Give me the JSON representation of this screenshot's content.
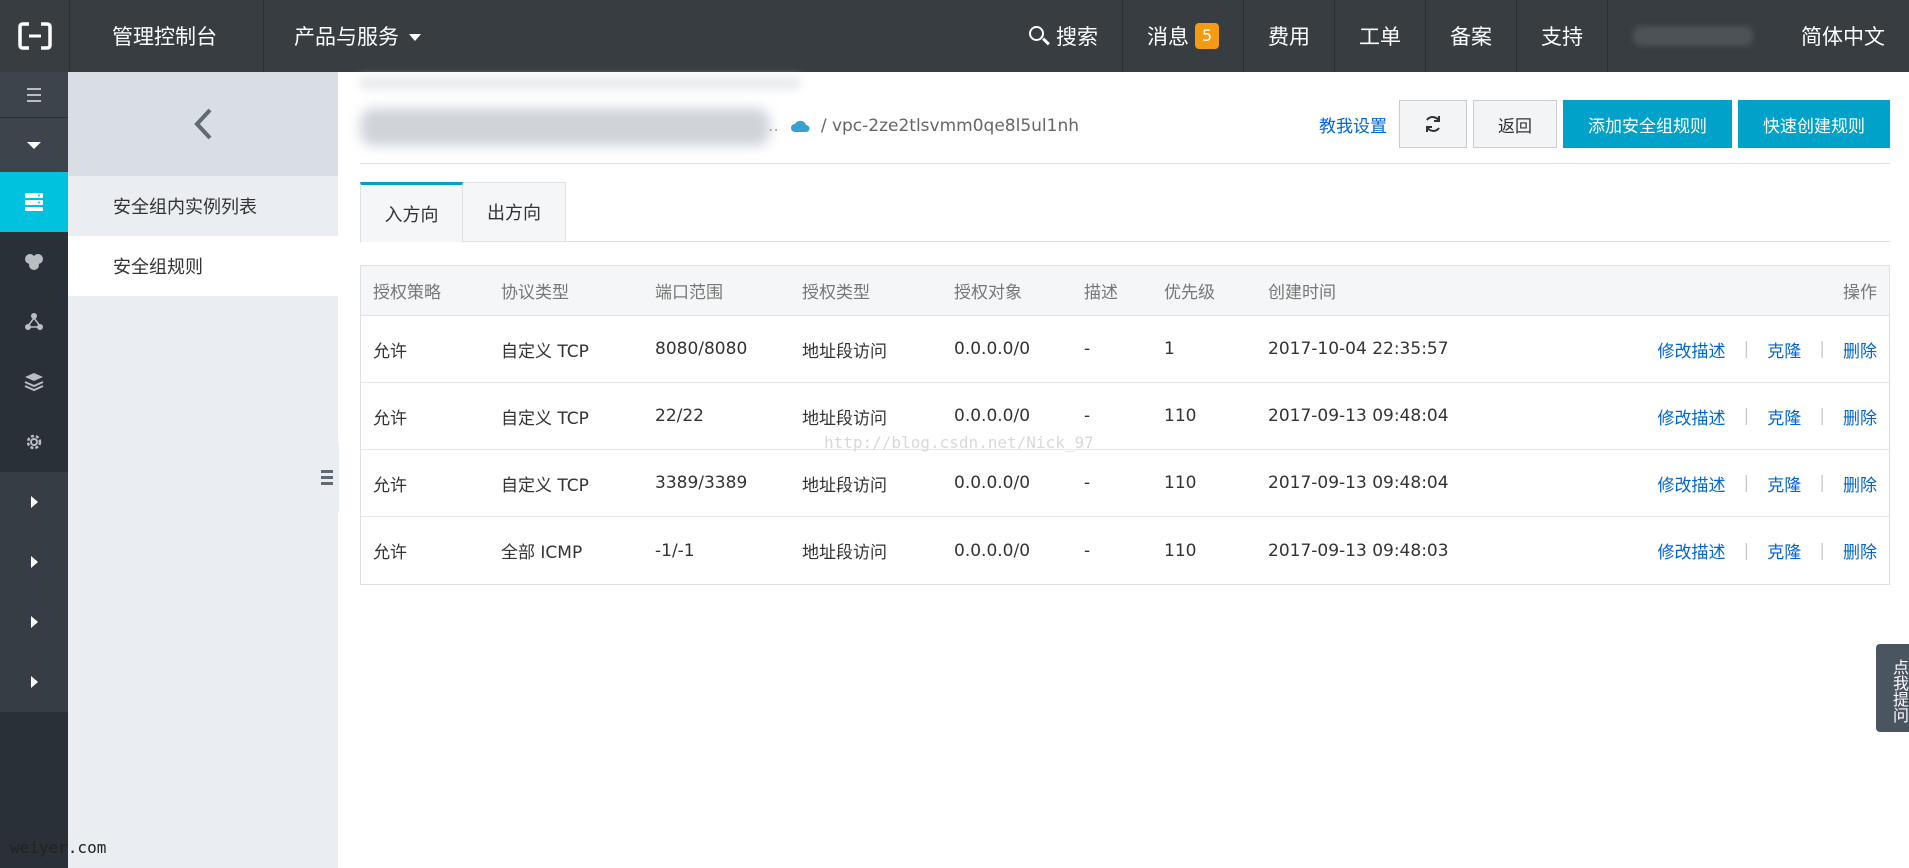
{
  "topbar": {
    "console": "管理控制台",
    "products": "产品与服务",
    "search": "搜索",
    "messages": "消息",
    "messages_count": "5",
    "billing": "费用",
    "tickets": "工单",
    "icp": "备案",
    "support": "支持",
    "language": "简体中文"
  },
  "subnav": {
    "items": [
      "安全组内实例列表",
      "安全组规则"
    ]
  },
  "header": {
    "breadcrumb_dots": "..",
    "vpc": "/ vpc-2ze2tlsvmm0qe8l5ul1nh",
    "help": "教我设置",
    "back": "返回",
    "add_rule": "添加安全组规则",
    "quick_create": "快速创建规则"
  },
  "tabs": [
    "入方向",
    "出方向"
  ],
  "table": {
    "columns": [
      "授权策略",
      "协议类型",
      "端口范围",
      "授权类型",
      "授权对象",
      "描述",
      "优先级",
      "创建时间",
      "操作"
    ],
    "rows": [
      [
        "允许",
        "自定义 TCP",
        "8080/8080",
        "地址段访问",
        "0.0.0.0/0",
        "-",
        "1",
        "2017-10-04 22:35:57"
      ],
      [
        "允许",
        "自定义 TCP",
        "22/22",
        "地址段访问",
        "0.0.0.0/0",
        "-",
        "110",
        "2017-09-13 09:48:04"
      ],
      [
        "允许",
        "自定义 TCP",
        "3389/3389",
        "地址段访问",
        "0.0.0.0/0",
        "-",
        "110",
        "2017-09-13 09:48:04"
      ],
      [
        "允许",
        "全部 ICMP",
        "-1/-1",
        "地址段访问",
        "0.0.0.0/0",
        "-",
        "110",
        "2017-09-13 09:48:03"
      ]
    ],
    "ops": [
      "修改描述",
      "克隆",
      "删除"
    ],
    "separator": "|"
  },
  "watermark": "http://blog.csdn.net/Nick_97",
  "site_mark": "weiyer.com",
  "feedback": "点我提问",
  "colors": {
    "topbar": "#373d41",
    "iconbar": "#293038",
    "active": "#00c1de",
    "primary": "#00a2ca",
    "link": "#0066cc",
    "badge": "#f39c12"
  }
}
